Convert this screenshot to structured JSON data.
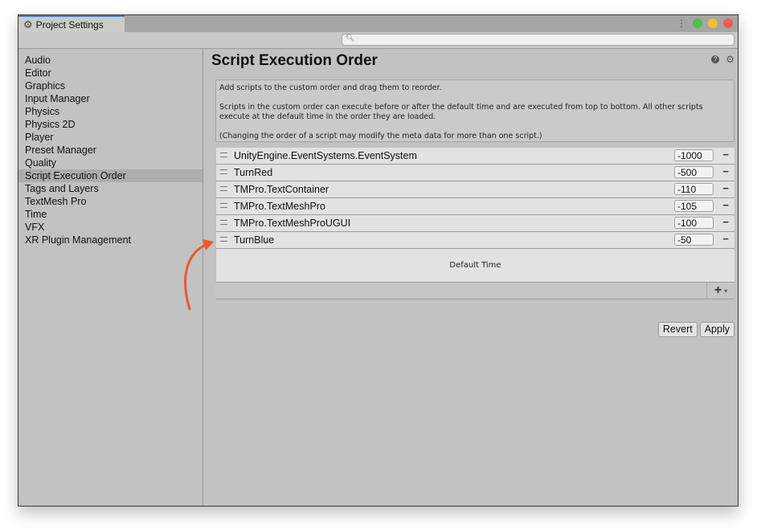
{
  "window": {
    "tab_title": "Project Settings",
    "tab_icon": "gear-icon",
    "controls": [
      {
        "name": "minimize",
        "color": "#4cc04a"
      },
      {
        "name": "maximize",
        "color": "#f4bf2f"
      },
      {
        "name": "close",
        "color": "#ed5b56"
      }
    ]
  },
  "search": {
    "placeholder": "",
    "value": ""
  },
  "sidebar": {
    "items": [
      {
        "label": "Audio"
      },
      {
        "label": "Editor"
      },
      {
        "label": "Graphics"
      },
      {
        "label": "Input Manager"
      },
      {
        "label": "Physics"
      },
      {
        "label": "Physics 2D"
      },
      {
        "label": "Player"
      },
      {
        "label": "Preset Manager"
      },
      {
        "label": "Quality"
      },
      {
        "label": "Script Execution Order",
        "selected": true
      },
      {
        "label": "Tags and Layers"
      },
      {
        "label": "TextMesh Pro"
      },
      {
        "label": "Time"
      },
      {
        "label": "VFX"
      },
      {
        "label": "XR Plugin Management"
      }
    ]
  },
  "main": {
    "title": "Script Execution Order",
    "info": [
      "Add scripts to the custom order and drag them to reorder.",
      "Scripts in the custom order can execute before or after the default time and are executed from top to bottom. All other scripts execute at the default time in the order they are loaded.",
      "(Changing the order of a script may modify the meta data for more than one script.)"
    ],
    "scripts": [
      {
        "name": "UnityEngine.EventSystems.EventSystem",
        "order": "-1000"
      },
      {
        "name": "TurnRed",
        "order": "-500"
      },
      {
        "name": "TMPro.TextContainer",
        "order": "-110"
      },
      {
        "name": "TMPro.TextMeshPro",
        "order": "-105"
      },
      {
        "name": "TMPro.TextMeshProUGUI",
        "order": "-100"
      },
      {
        "name": "TurnBlue",
        "order": "-50"
      }
    ],
    "remove_label": "−",
    "default_time_label": "Default Time",
    "add_label": "+",
    "add_caret": "▾",
    "revert_label": "Revert",
    "apply_label": "Apply"
  },
  "annotation": {
    "arrow_color": "#e85a2c"
  }
}
